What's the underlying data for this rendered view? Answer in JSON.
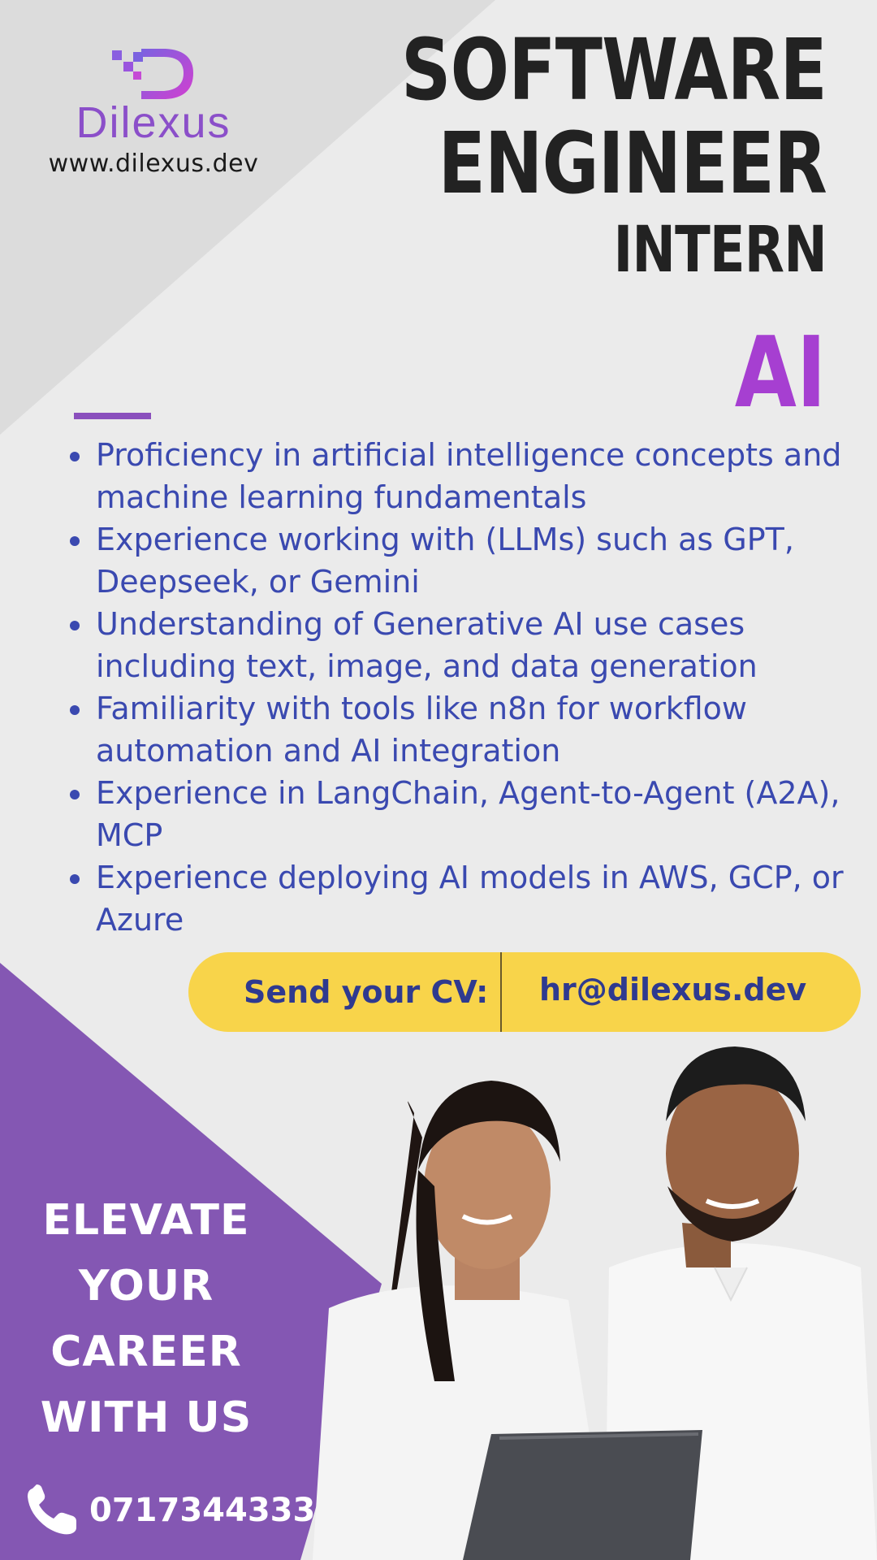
{
  "brand": {
    "name": "Dilexus",
    "website": "www.dilexus.dev"
  },
  "headline": {
    "line1": "SOFTWARE",
    "line2": "ENGINEER",
    "line3": "INTERN",
    "specialty": "AI"
  },
  "requirements": [
    "Proficiency in artificial intelligence concepts and machine learning fundamentals",
    "Experience working with (LLMs) such as GPT, Deepseek, or Gemini",
    "Understanding of Generative AI use cases including text, image, and data generation",
    "Familiarity with tools like n8n for workflow automation and AI integration",
    "Experience in LangChain, Agent-to-Agent (A2A), MCP",
    "Experience deploying AI models in AWS, GCP, or Azure"
  ],
  "cta": {
    "label": "Send your CV:",
    "email": "hr@dilexus.dev"
  },
  "slogan": [
    "ELEVATE",
    "YOUR",
    "CAREER",
    "WITH US"
  ],
  "contact": {
    "phone": "0717344333"
  },
  "colors": {
    "background": "#ebebeb",
    "accent_purple": "#a63fd1",
    "panel_purple": "#8457b3",
    "text_blue": "#3a49b0",
    "cta_yellow": "#f8d44a"
  },
  "icons": [
    "dilexus-logo-icon",
    "phone-icon"
  ]
}
